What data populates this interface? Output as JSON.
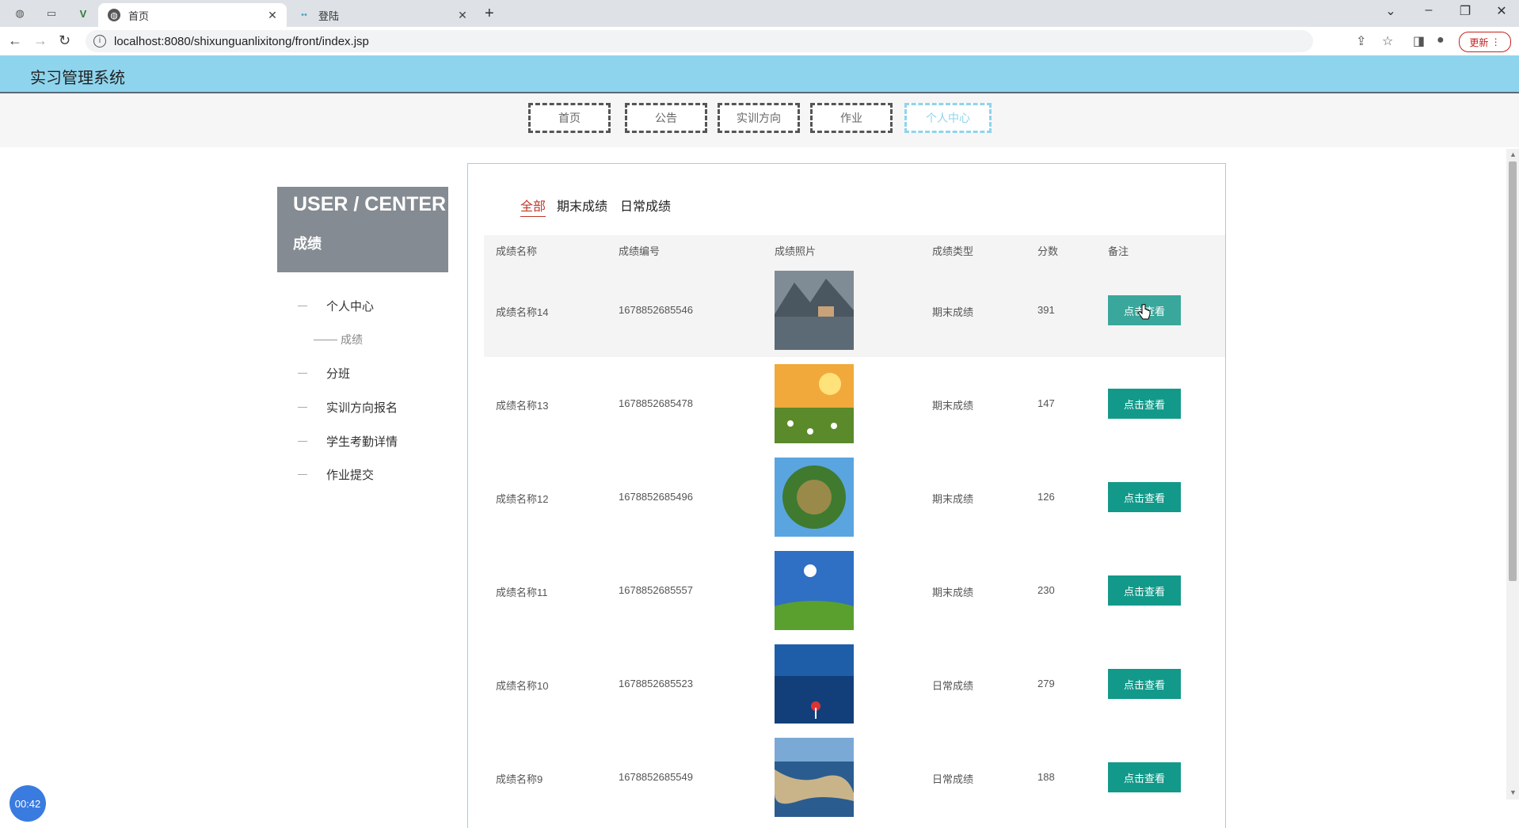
{
  "browser": {
    "tabs": [
      {
        "title": "首页",
        "active": true
      },
      {
        "title": "登陆",
        "active": false
      }
    ],
    "url": "localhost:8080/shixunguanlixitong/front/index.jsp",
    "update_label": "更新"
  },
  "site": {
    "title": "实习管理系统",
    "nav": [
      "首页",
      "公告",
      "实训方向",
      "作业",
      "个人中心"
    ],
    "nav_active": "个人中心"
  },
  "sidebar": {
    "header_title": "USER / CENTER",
    "header_sub": "成绩",
    "items": [
      {
        "label": "个人中心"
      },
      {
        "label": "成绩",
        "sub": true
      },
      {
        "label": "分班"
      },
      {
        "label": "实训方向报名"
      },
      {
        "label": "学生考勤详情"
      },
      {
        "label": "作业提交"
      }
    ]
  },
  "filters": [
    "全部",
    "期末成绩",
    "日常成绩"
  ],
  "filter_active": "全部",
  "table": {
    "headers": [
      "成绩名称",
      "成绩编号",
      "成绩照片",
      "成绩类型",
      "分数",
      "备注"
    ],
    "rows": [
      {
        "name": "成绩名称14",
        "code": "1678852685546",
        "type": "期末成绩",
        "score": "391",
        "action": "点击查看"
      },
      {
        "name": "成绩名称13",
        "code": "1678852685478",
        "type": "期末成绩",
        "score": "147",
        "action": "点击查看"
      },
      {
        "name": "成绩名称12",
        "code": "1678852685496",
        "type": "期末成绩",
        "score": "126",
        "action": "点击查看"
      },
      {
        "name": "成绩名称11",
        "code": "1678852685557",
        "type": "期末成绩",
        "score": "230",
        "action": "点击查看"
      },
      {
        "name": "成绩名称10",
        "code": "1678852685523",
        "type": "日常成绩",
        "score": "279",
        "action": "点击查看"
      },
      {
        "name": "成绩名称9",
        "code": "1678852685549",
        "type": "日常成绩",
        "score": "188",
        "action": "点击查看"
      }
    ]
  },
  "timer": "00:42"
}
